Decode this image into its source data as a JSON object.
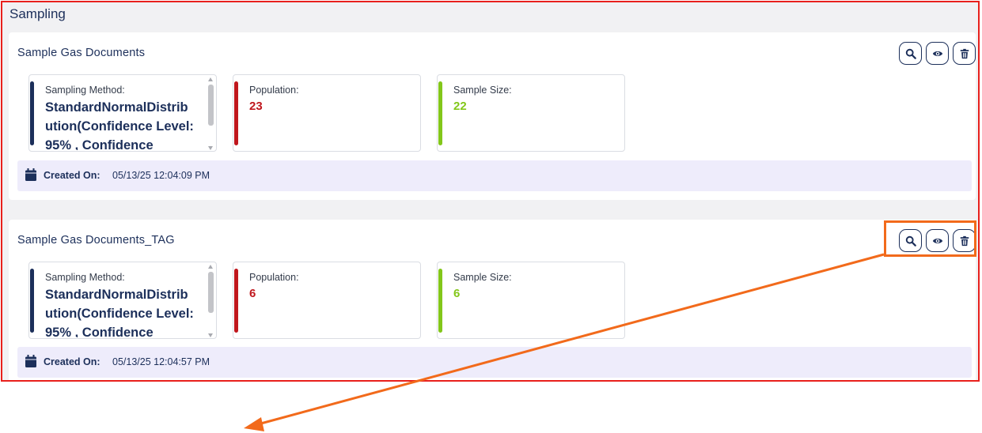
{
  "page": {
    "title": "Sampling"
  },
  "labels": {
    "method": "Sampling Method:",
    "population": "Population:",
    "sample_size": "Sample Size:",
    "created_on": "Created On:"
  },
  "cards": [
    {
      "title": "Sample Gas Documents",
      "method": "StandardNormalDistribution(Confidence Level:95% , Confidence",
      "population": "23",
      "sample_size": "22",
      "created": "05/13/25 12:04:09 PM"
    },
    {
      "title": "Sample Gas Documents_TAG",
      "method": "StandardNormalDistribution(Confidence Level:95% , Confidence",
      "population": "6",
      "sample_size": "6",
      "created": "05/13/25 12:04:57 PM"
    }
  ],
  "icons": {
    "search": "search-icon",
    "view": "eye-icon",
    "delete": "trash-icon",
    "calendar": "calendar-icon"
  },
  "colors": {
    "navy": "#1c2f5a",
    "population": "#c0171d",
    "sample_size": "#83c71a",
    "outline": "#e8201c",
    "annotation": "#f26a1b",
    "created_bg": "#eeecfb"
  }
}
